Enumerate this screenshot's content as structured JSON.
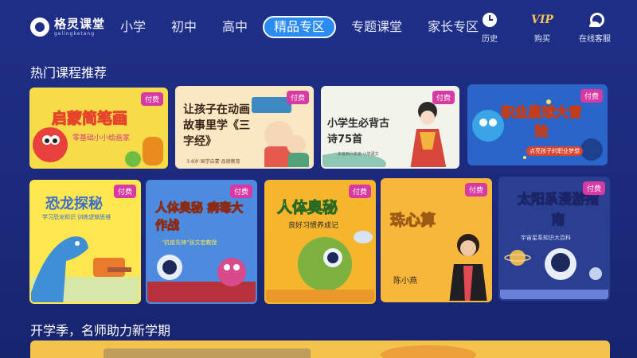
{
  "brand": {
    "name": "格灵课堂",
    "pinyin": "gelingketang"
  },
  "nav": {
    "items": [
      {
        "label": "小学",
        "active": false
      },
      {
        "label": "初中",
        "active": false
      },
      {
        "label": "高中",
        "active": false
      },
      {
        "label": "精品专区",
        "active": true
      },
      {
        "label": "专题课堂",
        "active": false
      },
      {
        "label": "家长专区",
        "active": false
      }
    ]
  },
  "actions": [
    {
      "label": "历史",
      "icon": "clock-icon"
    },
    {
      "label": "购买",
      "icon": "vip-icon",
      "icon_text": "VIP"
    },
    {
      "label": "在线客服",
      "icon": "customer-service-icon"
    }
  ],
  "sections": {
    "hot": {
      "title": "热门课程推荐"
    },
    "school": {
      "title": "开学季，名师助力新学期"
    }
  },
  "paid_badge": "付费",
  "courses": [
    {
      "title": "启蒙简笔画",
      "subtitle": "零基础小小绘画家"
    },
    {
      "title": "让孩子在动画故事里学《三字经》",
      "subtitle": "3-8岁·国学启蒙·品德教育"
    },
    {
      "title": "小学生必背古诗75首",
      "subtitle": "一年级到六年级·小学语文"
    },
    {
      "title": "职业星球大冒险",
      "subtitle": "点亮孩子的职业梦想"
    },
    {
      "title": "恐龙探秘",
      "subtitle": "学习恐龙知识 训练逻辑思维"
    },
    {
      "title": "人体奥秘 病毒大作战",
      "subtitle": "\"抗疫先锋\"张文宏教授"
    },
    {
      "title": "人体奥秘",
      "subtitle": "良好习惯养成记"
    },
    {
      "title": "珠心算",
      "subtitle": "陈小燕"
    },
    {
      "title": "太阳系漫游指南",
      "subtitle": "宇宙星系知识大百科"
    }
  ],
  "colors": {
    "background": "#1f2f86",
    "nav_active": "#2a8bf2",
    "vip": "#f3c15a",
    "badge": "#d83aa3"
  }
}
